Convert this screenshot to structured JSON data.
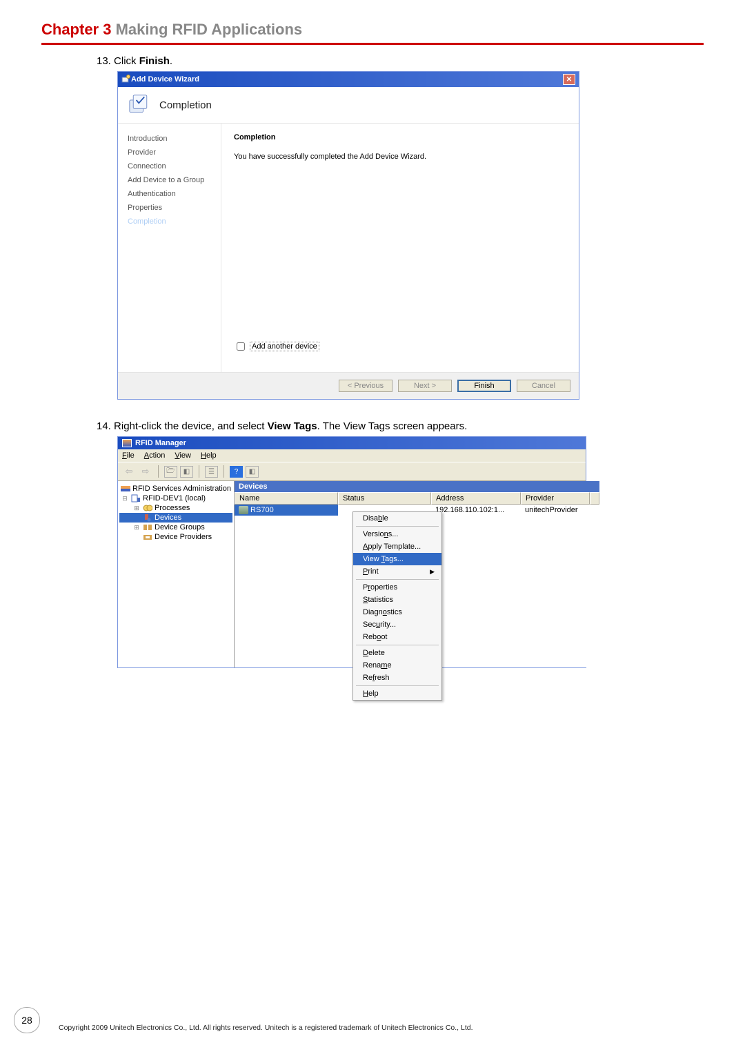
{
  "chapter": {
    "label": "Chapter 3",
    "title": "Making RFID Applications"
  },
  "step13": {
    "number": "13.",
    "prefix": "Click ",
    "bold": "Finish",
    "suffix": "."
  },
  "step14": {
    "number": "14.",
    "prefix": "Right-click the device, and select ",
    "bold": "View Tags",
    "suffix": ". The View Tags screen appears."
  },
  "dialog": {
    "title": "Add Device Wizard",
    "banner": "Completion",
    "steps": [
      "Introduction",
      "Provider",
      "Connection",
      "Add Device to a Group",
      "Authentication",
      "Properties",
      "Completion"
    ],
    "active_step_index": 6,
    "heading": "Completion",
    "message": "You have successfully completed the Add Device Wizard.",
    "checkbox_label": "Add another device",
    "buttons": {
      "previous": "< Previous",
      "next": "Next >",
      "finish": "Finish",
      "cancel": "Cancel"
    }
  },
  "manager": {
    "title": "RFID Manager",
    "menubar": {
      "file": "File",
      "action": "Action",
      "view": "View",
      "help": "Help"
    },
    "tree": {
      "root": "RFID Services Administration",
      "server": "RFID-DEV1 (local)",
      "processes": "Processes",
      "devices": "Devices",
      "device_groups": "Device Groups",
      "device_providers": "Device Providers"
    },
    "list": {
      "title": "Devices",
      "columns": {
        "name": "Name",
        "status": "Status",
        "address": "Address",
        "provider": "Provider"
      },
      "row": {
        "name": "RS700",
        "address": "192.168.110.102:1...",
        "provider": "unitechProvider"
      }
    },
    "context_menu": {
      "disable": "Disable",
      "versions": "Versions...",
      "apply_template": "Apply Template...",
      "view_tags": "View Tags...",
      "print": "Print",
      "properties": "Properties",
      "statistics": "Statistics",
      "diagnostics": "Diagnostics",
      "security": "Security...",
      "reboot": "Reboot",
      "delete": "Delete",
      "rename": "Rename",
      "refresh": "Refresh",
      "help": "Help"
    }
  },
  "footer": {
    "page_number": "28",
    "copyright": "Copyright 2009 Unitech Electronics Co., Ltd. All rights reserved. Unitech is a registered trademark of Unitech Electronics Co., Ltd."
  }
}
